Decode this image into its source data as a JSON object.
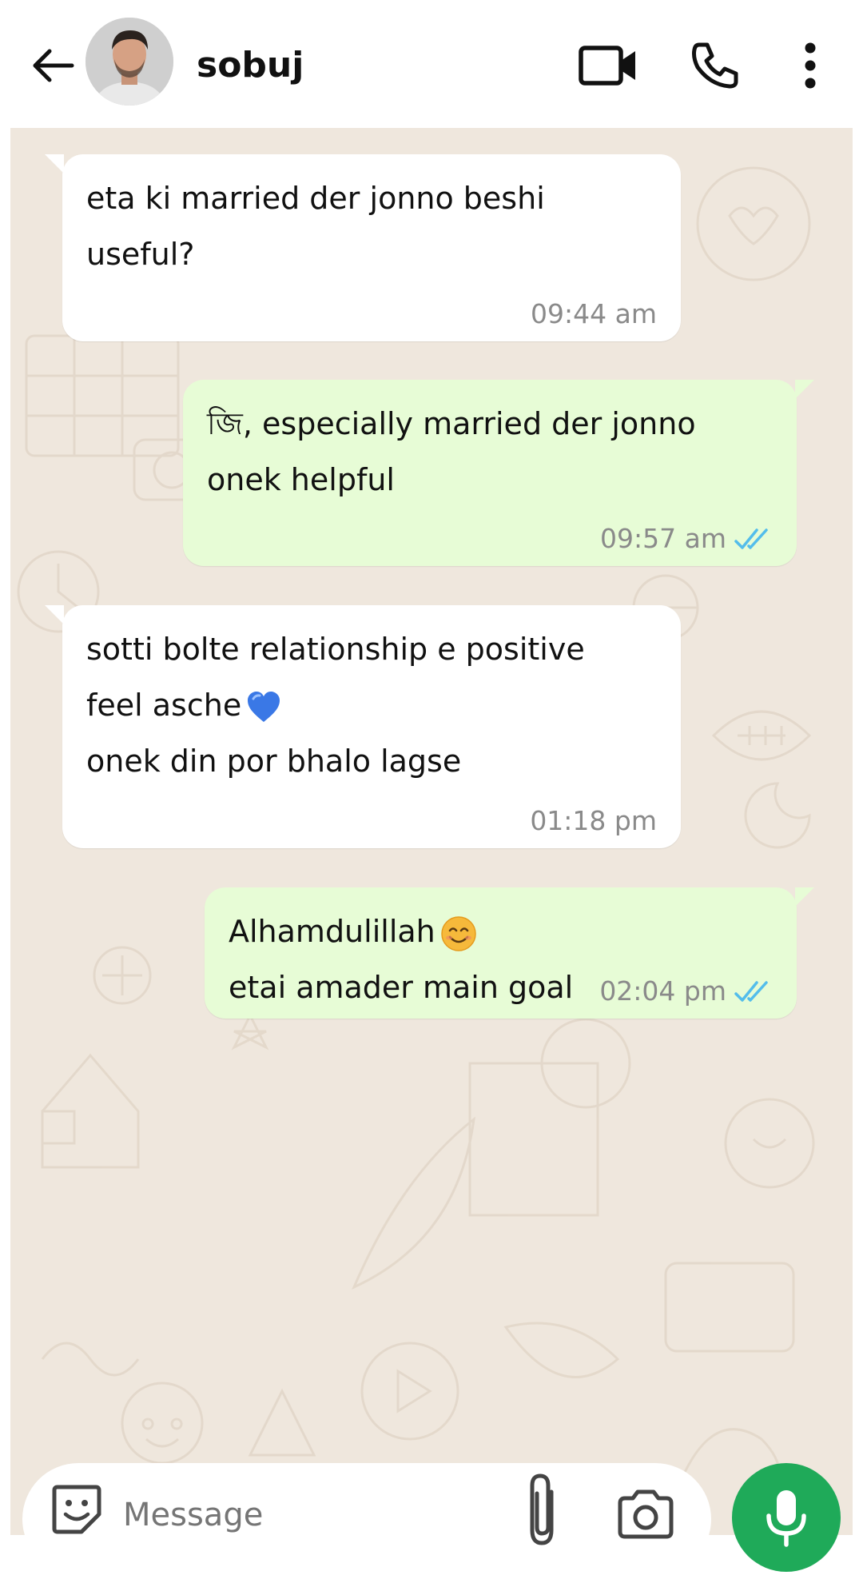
{
  "header": {
    "contact_name": "sobuj",
    "icons": {
      "back": "arrow-left-icon",
      "video": "video-camera-icon",
      "call": "phone-icon",
      "menu": "more-vertical-icon"
    }
  },
  "messages": [
    {
      "direction": "incoming",
      "text": "eta ki married der jonno beshi\nuseful?",
      "time": "09:44 am"
    },
    {
      "direction": "outgoing",
      "text": "জি, especially married der jonno\nonek helpful",
      "time": "09:57 am",
      "status": "read"
    },
    {
      "direction": "incoming",
      "line1": "sotti bolte relationship e positive",
      "line2": "feel asche",
      "line3": "onek din por bhalo lagse",
      "emoji": "blue-heart",
      "time": "01:18 pm"
    },
    {
      "direction": "outgoing",
      "line1": "Alhamdulillah",
      "line2": "etai amader main goal",
      "emoji": "smiling-face",
      "time": "02:04 pm",
      "status": "read"
    }
  ],
  "composer": {
    "placeholder": "Message"
  },
  "colors": {
    "incoming_bubble": "#ffffff",
    "outgoing_bubble": "#e7fcd6",
    "chat_background": "#efe7dd",
    "read_ticks": "#53bdeb",
    "mic_button": "#1faa59"
  }
}
